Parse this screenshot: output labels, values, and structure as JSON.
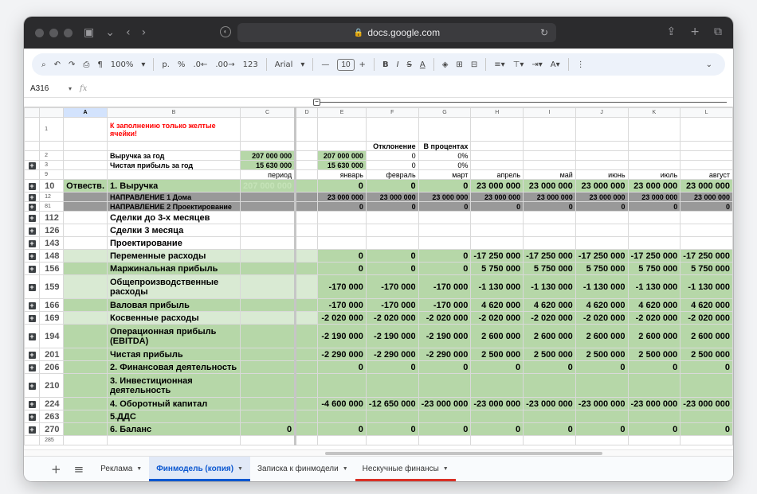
{
  "browser": {
    "url": "docs.google.com"
  },
  "toolbar": {
    "zoom": "100%",
    "currency": "р.",
    "percent": "%",
    "dec_minus": ".0←",
    "dec_plus": ".00→",
    "num_format": "123",
    "font": "Arial",
    "font_size": "10"
  },
  "formula_bar": {
    "cell_ref": "A316",
    "fx": "fx"
  },
  "columns": [
    "A",
    "B",
    "C",
    "D",
    "E",
    "F",
    "G",
    "H",
    "I",
    "J",
    "K",
    "L"
  ],
  "rows": [
    {
      "n": "1",
      "plus": false,
      "style": "",
      "cells": [
        "",
        "К заполнению только желтые ячейки!",
        "",
        "",
        "",
        "",
        "",
        "",
        "",
        "",
        "",
        ""
      ]
    },
    {
      "n": "",
      "plus": false,
      "style": "",
      "cells": [
        "",
        "",
        "",
        "",
        "",
        "Отклонение",
        "В процентах",
        "",
        "",
        "",
        "",
        ""
      ]
    },
    {
      "n": "2",
      "plus": false,
      "style": "",
      "cells": [
        "",
        "Выручка за год",
        "207 000 000",
        "",
        "207 000 000",
        "0",
        "0%",
        "",
        "",
        "",
        "",
        ""
      ]
    },
    {
      "n": "3",
      "plus": true,
      "style": "",
      "cells": [
        "",
        "Чистая прибыль за год",
        "15 630 000",
        "",
        "15 630 000",
        "0",
        "0%",
        "",
        "",
        "",
        "",
        ""
      ]
    },
    {
      "n": "9",
      "plus": false,
      "style": "",
      "cells": [
        "",
        "",
        "период",
        "",
        "январь",
        "февраль",
        "март",
        "апрель",
        "май",
        "июнь",
        "июль",
        "август"
      ]
    },
    {
      "n": "10",
      "plus": true,
      "style": "big",
      "cells": [
        "Отвеств.",
        "1. Выручка",
        "207 000 000",
        "",
        "0",
        "0",
        "0",
        "23 000 000",
        "23 000 000",
        "23 000 000",
        "23 000 000",
        "23 000 000"
      ]
    },
    {
      "n": "12",
      "plus": true,
      "style": "grey",
      "cells": [
        "",
        "НАПРАВЛЕНИЕ 1 Дома",
        "",
        "",
        "23 000 000",
        "23 000 000",
        "23 000 000",
        "23 000 000",
        "23 000 000",
        "23 000 000",
        "23 000 000",
        "23 000 000"
      ]
    },
    {
      "n": "81",
      "plus": true,
      "style": "grey",
      "cells": [
        "",
        "НАПРАВЛЕНИЕ 2 Проектирование",
        "",
        "",
        "0",
        "0",
        "0",
        "0",
        "0",
        "0",
        "0",
        "0"
      ]
    },
    {
      "n": "112",
      "plus": true,
      "style": "plain",
      "cells": [
        "",
        "Сделки до 3-х месяцев",
        "",
        "",
        "",
        "",
        "",
        "",
        "",
        "",
        "",
        ""
      ]
    },
    {
      "n": "126",
      "plus": true,
      "style": "plain",
      "cells": [
        "",
        "Сделки 3 месяца",
        "",
        "",
        "",
        "",
        "",
        "",
        "",
        "",
        "",
        ""
      ]
    },
    {
      "n": "143",
      "plus": true,
      "style": "plain",
      "cells": [
        "",
        "Проектирование",
        "",
        "",
        "",
        "",
        "",
        "",
        "",
        "",
        "",
        ""
      ]
    },
    {
      "n": "148",
      "plus": true,
      "style": "lg",
      "cells": [
        "",
        "Переменные расходы",
        "",
        "",
        "0",
        "0",
        "0",
        "-17 250 000",
        "-17 250 000",
        "-17 250 000",
        "-17 250 000",
        "-17 250 000"
      ]
    },
    {
      "n": "156",
      "plus": true,
      "style": "g",
      "cells": [
        "",
        "Маржинальная прибыль",
        "",
        "",
        "0",
        "0",
        "0",
        "5 750 000",
        "5 750 000",
        "5 750 000",
        "5 750 000",
        "5 750 000"
      ]
    },
    {
      "n": "159",
      "plus": true,
      "style": "lg2",
      "cells": [
        "",
        "Общепроизводственные расходы",
        "",
        "",
        "-170 000",
        "-170 000",
        "-170 000",
        "-1 130 000",
        "-1 130 000",
        "-1 130 000",
        "-1 130 000",
        "-1 130 000"
      ]
    },
    {
      "n": "166",
      "plus": true,
      "style": "g",
      "cells": [
        "",
        "Валовая прибыль",
        "",
        "",
        "-170 000",
        "-170 000",
        "-170 000",
        "4 620 000",
        "4 620 000",
        "4 620 000",
        "4 620 000",
        "4 620 000"
      ]
    },
    {
      "n": "169",
      "plus": true,
      "style": "lg",
      "cells": [
        "",
        "Косвенные расходы",
        "",
        "",
        "-2 020 000",
        "-2 020 000",
        "-2 020 000",
        "-2 020 000",
        "-2 020 000",
        "-2 020 000",
        "-2 020 000",
        "-2 020 000"
      ]
    },
    {
      "n": "194",
      "plus": true,
      "style": "g2",
      "cells": [
        "",
        "Операционная прибыль (EBITDA)",
        "",
        "",
        "-2 190 000",
        "-2 190 000",
        "-2 190 000",
        "2 600 000",
        "2 600 000",
        "2 600 000",
        "2 600 000",
        "2 600 000"
      ]
    },
    {
      "n": "201",
      "plus": true,
      "style": "g",
      "cells": [
        "",
        "Чистая прибыль",
        "",
        "",
        "-2 290 000",
        "-2 290 000",
        "-2 290 000",
        "2 500 000",
        "2 500 000",
        "2 500 000",
        "2 500 000",
        "2 500 000"
      ]
    },
    {
      "n": "206",
      "plus": true,
      "style": "g",
      "cells": [
        "",
        "2. Финансовая деятельность",
        "",
        "",
        "0",
        "0",
        "0",
        "0",
        "0",
        "0",
        "0",
        "0"
      ]
    },
    {
      "n": "210",
      "plus": true,
      "style": "g2",
      "cells": [
        "",
        "3. Инвестиционная деятельность",
        "",
        "",
        "",
        "",
        "",
        "",
        "",
        "",
        "",
        ""
      ]
    },
    {
      "n": "224",
      "plus": true,
      "style": "g",
      "cells": [
        "",
        "4. Оборотный капитал",
        "",
        "",
        "-4 600 000",
        "-12 650 000",
        "-23 000 000",
        "-23 000 000",
        "-23 000 000",
        "-23 000 000",
        "-23 000 000",
        "-23 000 000"
      ]
    },
    {
      "n": "263",
      "plus": true,
      "style": "g",
      "cells": [
        "",
        "5.ДДС",
        "",
        "",
        "",
        "",
        "",
        "",
        "",
        "",
        "",
        ""
      ]
    },
    {
      "n": "270",
      "plus": true,
      "style": "g",
      "cells": [
        "",
        "6. Баланс",
        "0",
        "",
        "0",
        "0",
        "0",
        "0",
        "0",
        "0",
        "0",
        "0"
      ]
    },
    {
      "n": "285",
      "plus": false,
      "style": "",
      "cells": [
        "",
        "",
        "",
        "",
        "",
        "",
        "",
        "",
        "",
        "",
        "",
        ""
      ]
    }
  ],
  "sheets": [
    {
      "label": "Реклама",
      "active": false,
      "red": false
    },
    {
      "label": "Финмодель (копия)",
      "active": true,
      "red": false
    },
    {
      "label": "Записка к финмодели",
      "active": false,
      "red": false
    },
    {
      "label": "Нескучные финансы",
      "active": false,
      "red": true
    }
  ]
}
